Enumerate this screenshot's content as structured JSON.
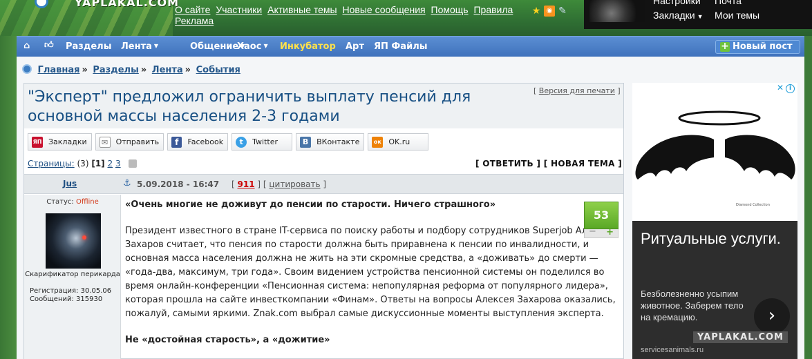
{
  "header": {
    "logo_text": "YAPLAKAL.COM",
    "top_links": [
      "О сайте",
      "Участники",
      "Активные темы",
      "Новые сообщения",
      "Помощь",
      "Правила",
      "Реклама"
    ],
    "user_links": {
      "settings": "Настройки",
      "mail": "Почта",
      "bookmarks": "Закладки",
      "my_topics": "Мои темы"
    },
    "icons": [
      "star-icon",
      "rss-icon",
      "wrench-icon"
    ]
  },
  "nav": {
    "items": [
      {
        "label": "Разделы"
      },
      {
        "label": "Лента",
        "dropdown": true
      },
      {
        "label": "Общение",
        "dropdown": true
      },
      {
        "label": "Хаос",
        "dropdown": true
      },
      {
        "label": "Инкубатор",
        "highlight": true
      },
      {
        "label": "Арт"
      },
      {
        "label": "ЯП Файлы"
      }
    ],
    "new_post": "Новый пост"
  },
  "breadcrumb": [
    "Главная",
    "Разделы",
    "Лента",
    "События"
  ],
  "topic": {
    "title": "\"Эксперт\" предложил ограничить выплату пенсий для основной массы населения 2-3 годами",
    "print_link": "Версия для печати"
  },
  "share": [
    {
      "label": "Закладки",
      "icon": "yap-icon",
      "color": "#c8102e",
      "glyph": "ЯП"
    },
    {
      "label": "Отправить",
      "icon": "mail-icon",
      "color": "#888888",
      "glyph": "✉"
    },
    {
      "label": "Facebook",
      "icon": "facebook-icon",
      "color": "#3b5998",
      "glyph": "f"
    },
    {
      "label": "Twitter",
      "icon": "twitter-icon",
      "color": "#3aa0e6",
      "glyph": "t"
    },
    {
      "label": "ВКонтакте",
      "icon": "vk-icon",
      "color": "#4a76a8",
      "glyph": "B"
    },
    {
      "label": "OK.ru",
      "icon": "ok-icon",
      "color": "#ee8208",
      "glyph": "ок"
    }
  ],
  "pages": {
    "label": "Страницы:",
    "count": "(3)",
    "current": "1",
    "others": [
      "2",
      "3"
    ]
  },
  "actions": {
    "reply": "ОТВЕТИТЬ",
    "new_topic": "НОВАЯ ТЕМА"
  },
  "post": {
    "author": "Jus",
    "date": "5.09.2018 - 16:47",
    "votes": "911",
    "quote": "цитировать",
    "rating": "53",
    "lead": "«Очень многие не доживут до пенсии по старости. Ничего страшного»",
    "paragraph": "Президент известного в стране IT-сервиса по поиску работы и подбору сотрудников Superjob Алексей Захаров считает, что пенсия по старости должна быть приравнена к пенсии по инвалидности, и основная масса населения должна не жить на эти скромные средства, а «доживать» до смерти — «года-два, максимум, три года». Своим видением устройства пенсионной системы он поделился во время онлайн-конференции «Пенсионная система: непопулярная реформа от популярного лидера», которая прошла на сайте инвесткомпании «Финам». Ответы на вопросы Алексея Захарова оказались, пожалуй, самыми яркими. Znak.com выбрал самые дискуссионные моменты выступления эксперта.",
    "subheading": "Не «достойная старость», а «дожитие»"
  },
  "user": {
    "status_label": "Статус:",
    "status_value": "Offline",
    "rank": "Скарификатор перикарда",
    "registration": "Регистрация: 30.05.06",
    "posts": "Сообщений: 315930"
  },
  "ad": {
    "brand_small": "Diamond Collection",
    "headline": "Ритуальные услуги.",
    "description": "Безболезненно усыпим животное. Заберем тело на кремацию.",
    "site": "servicesanimals.ru",
    "watermark": "YAPLAKAL.COM"
  }
}
